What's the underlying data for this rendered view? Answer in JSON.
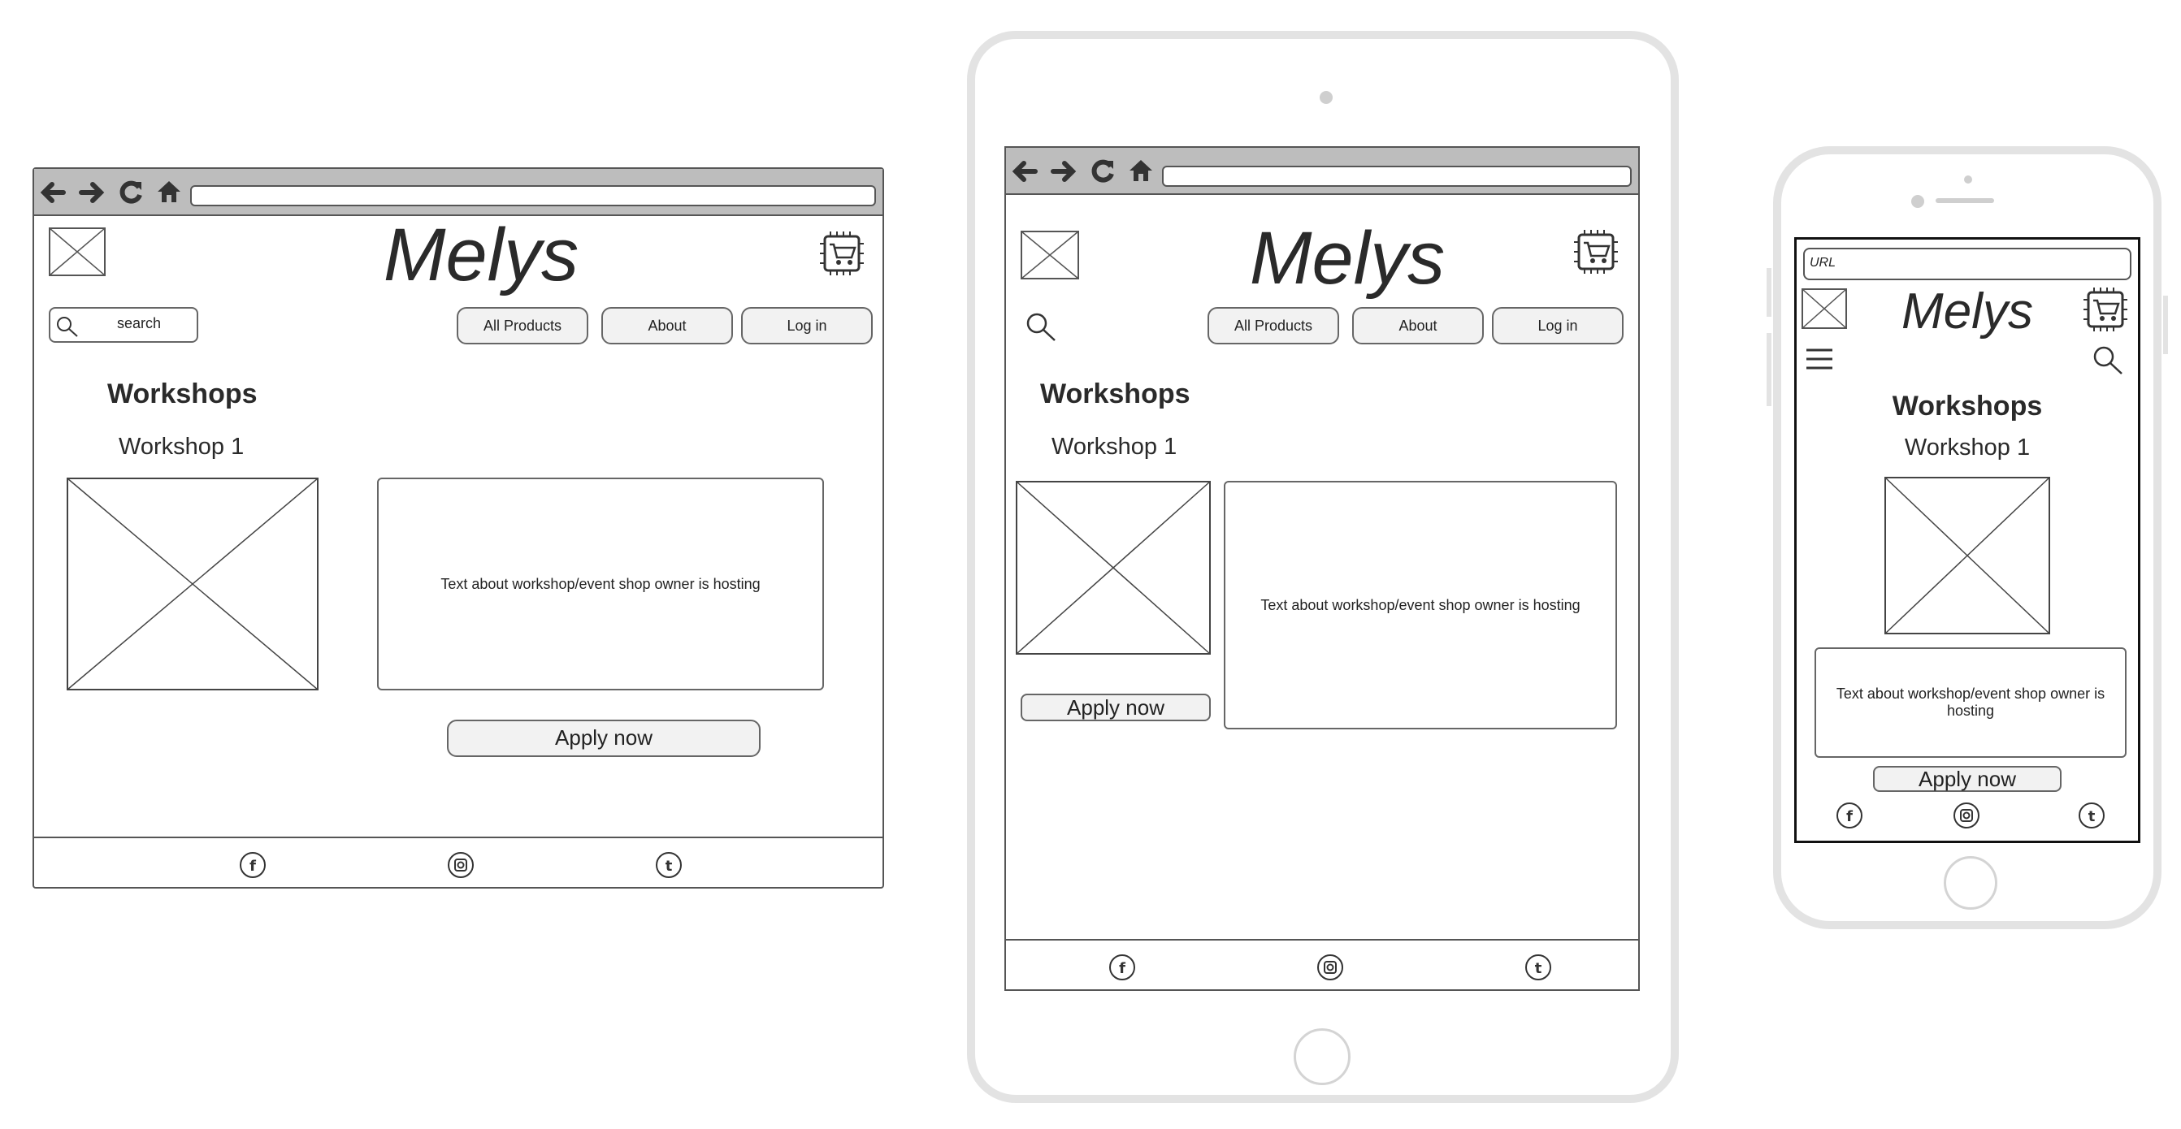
{
  "brand": {
    "name": "Melys"
  },
  "nav": {
    "all_products": "All Products",
    "about": "About",
    "log_in": "Log in"
  },
  "search": {
    "label": "search"
  },
  "url_placeholder": "URL",
  "page": {
    "heading": "Workshops",
    "workshop_title": "Workshop 1",
    "workshop_text": "Text about workshop/event shop owner is hosting",
    "apply_label": "Apply now"
  },
  "icons": {
    "back": "arrow-left-icon",
    "forward": "arrow-right-icon",
    "reload": "reload-icon",
    "home": "home-icon",
    "cart": "cart-icon",
    "search": "search-icon",
    "menu": "hamburger-menu-icon",
    "facebook": "facebook-icon",
    "instagram": "instagram-icon",
    "tumblr": "tumblr-icon",
    "image": "image-placeholder-icon"
  },
  "colors": {
    "chrome": "#bdbdbd",
    "device_bezel": "#e3e3e3",
    "button_fill": "#f2f2f2"
  }
}
